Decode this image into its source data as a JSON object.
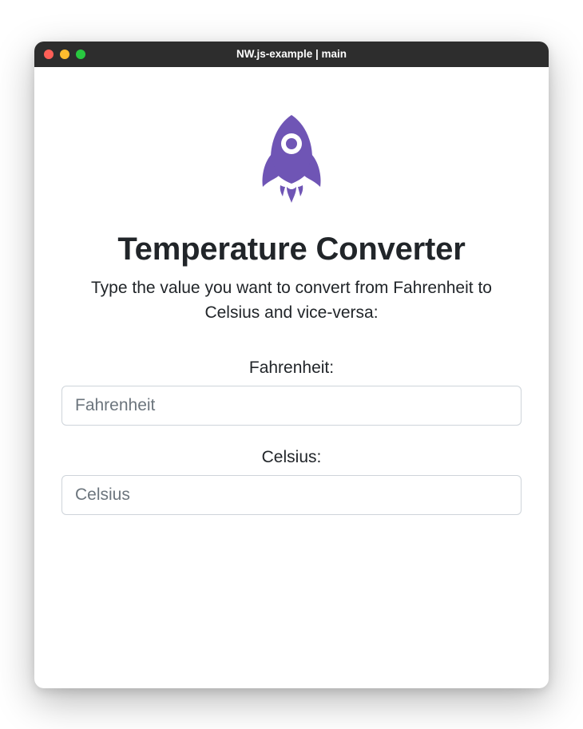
{
  "window": {
    "title": "NW.js-example | main"
  },
  "logo": {
    "color": "#6f55b5"
  },
  "main": {
    "title": "Temperature Converter",
    "subtitle": "Type the value you want to convert from Fahrenheit to Celsius and vice-versa:"
  },
  "fields": {
    "fahrenheit": {
      "label": "Fahrenheit:",
      "placeholder": "Fahrenheit",
      "value": ""
    },
    "celsius": {
      "label": "Celsius:",
      "placeholder": "Celsius",
      "value": ""
    }
  }
}
